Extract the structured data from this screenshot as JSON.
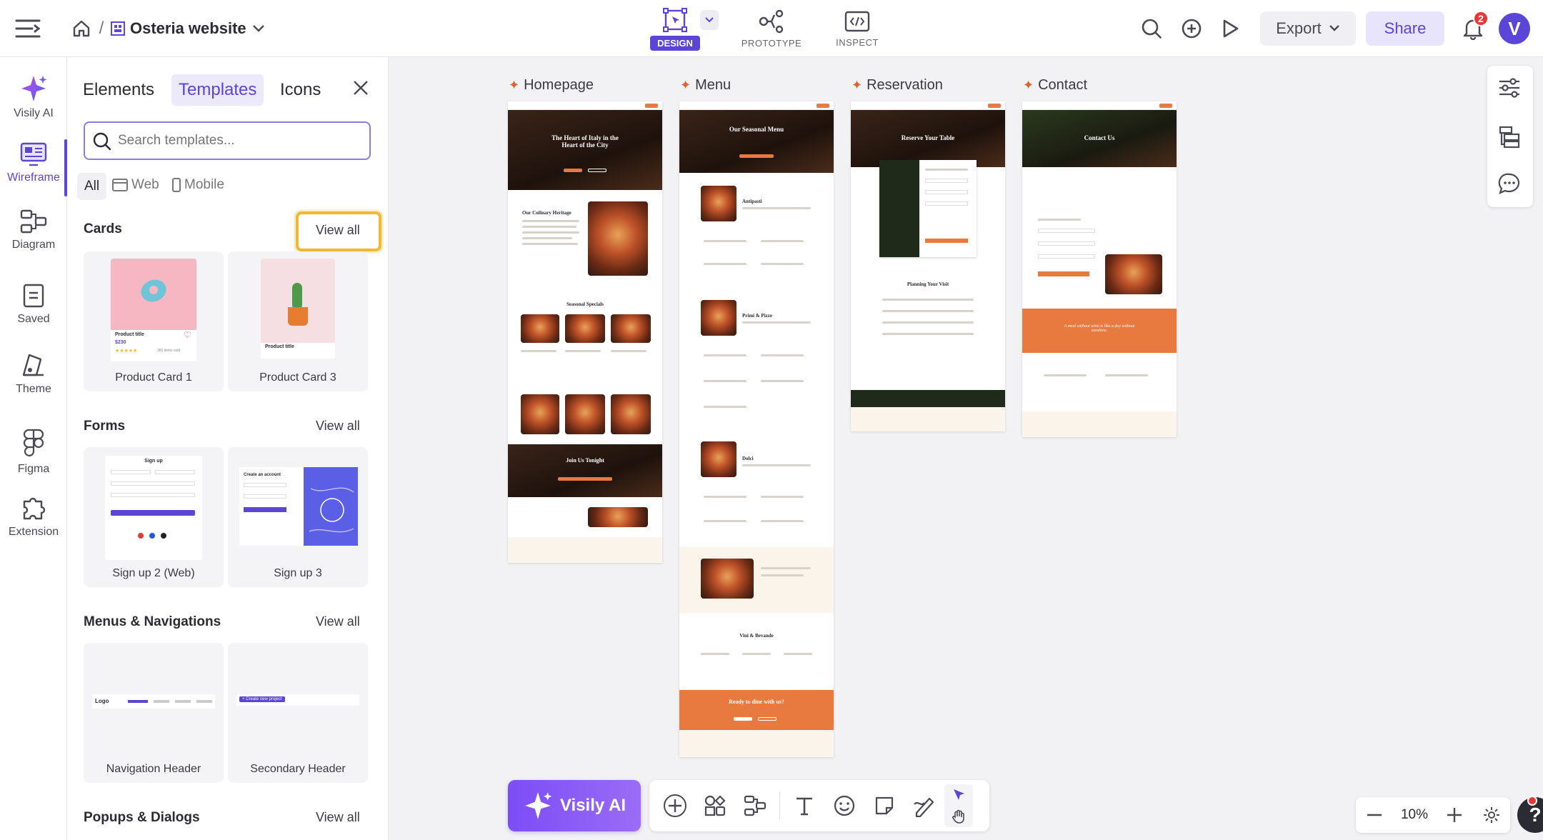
{
  "header": {
    "project_name": "Osteria website",
    "modes": [
      {
        "label": "DESIGN"
      },
      {
        "label": "PROTOTYPE"
      },
      {
        "label": "INSPECT"
      }
    ],
    "export_label": "Export",
    "share_label": "Share",
    "notification_count": "2",
    "avatar_letter": "V"
  },
  "rail": {
    "items": [
      {
        "label": "Visily AI"
      },
      {
        "label": "Wireframe"
      },
      {
        "label": "Diagram"
      },
      {
        "label": "Saved"
      },
      {
        "label": "Theme"
      },
      {
        "label": "Figma"
      },
      {
        "label": "Extension"
      }
    ]
  },
  "panel": {
    "tabs": [
      {
        "label": "Elements"
      },
      {
        "label": "Templates"
      },
      {
        "label": "Icons"
      }
    ],
    "search_placeholder": "Search templates...",
    "filters": [
      {
        "label": "All"
      },
      {
        "label": "Web"
      },
      {
        "label": "Mobile"
      }
    ],
    "view_all": "View all",
    "sections": [
      {
        "title": "Cards",
        "cards": [
          {
            "label": "Product Card 1"
          },
          {
            "label": "Product Card 3"
          }
        ]
      },
      {
        "title": "Forms",
        "cards": [
          {
            "label": "Sign up 2 (Web)"
          },
          {
            "label": "Sign up 3"
          }
        ]
      },
      {
        "title": "Menus & Navigations",
        "cards": [
          {
            "label": "Navigation Header"
          },
          {
            "label": "Secondary Header"
          }
        ]
      },
      {
        "title": "Popups & Dialogs"
      }
    ],
    "card_mini": {
      "product_title": "Product title",
      "price": "$230",
      "sold": "360 items sold",
      "signup": "Sign up",
      "create_account": "Create an account",
      "logo": "Logo",
      "create_project": "+ Create new project"
    }
  },
  "canvas": {
    "frames": [
      {
        "title": "Homepage"
      },
      {
        "title": "Menu"
      },
      {
        "title": "Reservation"
      },
      {
        "title": "Contact"
      }
    ],
    "mini_text": {
      "home_hero": "The Heart of Italy in the Heart of the City",
      "home_heritage": "Our Culinary Heritage",
      "home_specials": "Seasonal Specials",
      "home_join": "Join Us Tonight",
      "menu_hero": "Our Seasonal Menu",
      "menu_antipasti": "Antipasti",
      "menu_primi": "Primi & Pizze",
      "menu_dolci": "Dolci",
      "menu_vini": "Vini & Bevande",
      "menu_ready": "Ready to dine with us?",
      "res_hero": "Reserve Your Table",
      "res_planning": "Planning Your Visit",
      "contact_hero": "Contact Us",
      "contact_quote": "A meal without wine is like a day without sunshine."
    }
  },
  "bottom_toolbar": {
    "ai_label": "Visily AI"
  },
  "zoom": {
    "level": "10%"
  },
  "colors": {
    "accent": "#6c4df6",
    "orange": "#e8793f",
    "highlight": "#f5b731"
  }
}
